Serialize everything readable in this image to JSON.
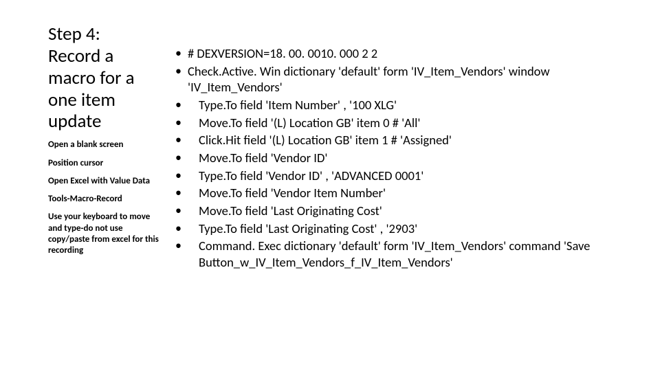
{
  "left": {
    "title": "Step 4:\nRecord a macro for a one item update",
    "subs": [
      "Open a blank screen",
      "Position cursor",
      "Open Excel with Value Data",
      "Tools-Macro-Record",
      "Use your keyboard to move and type-do not use copy/paste from excel for this recording"
    ]
  },
  "right": {
    "items": [
      {
        "text": "# DEXVERSION=18. 00. 0010. 000 2 2",
        "indent": false
      },
      {
        "text": "Check.Active. Win dictionary 'default'  form 'IV_Item_Vendors' window 'IV_Item_Vendors'",
        "indent": false
      },
      {
        "text": "Type.To field 'Item Number' , '100 XLG'",
        "indent": true
      },
      {
        "text": "Move.To field '(L) Location GB' item 0  # 'All'",
        "indent": true
      },
      {
        "text": "Click.Hit field '(L) Location GB' item 1  # 'Assigned'",
        "indent": true
      },
      {
        "text": "Move.To field 'Vendor ID'",
        "indent": true
      },
      {
        "text": "Type.To field 'Vendor ID' , 'ADVANCED 0001'",
        "indent": true
      },
      {
        "text": "Move.To field 'Vendor Item Number'",
        "indent": true
      },
      {
        "text": "Move.To field 'Last Originating Cost'",
        "indent": true
      },
      {
        "text": "Type.To field 'Last Originating Cost' , '2903'",
        "indent": true
      },
      {
        "text": "Command. Exec dictionary 'default'  form 'IV_Item_Vendors' command 'Save Button_w_IV_Item_Vendors_f_IV_Item_Vendors'",
        "indent": true
      }
    ]
  }
}
